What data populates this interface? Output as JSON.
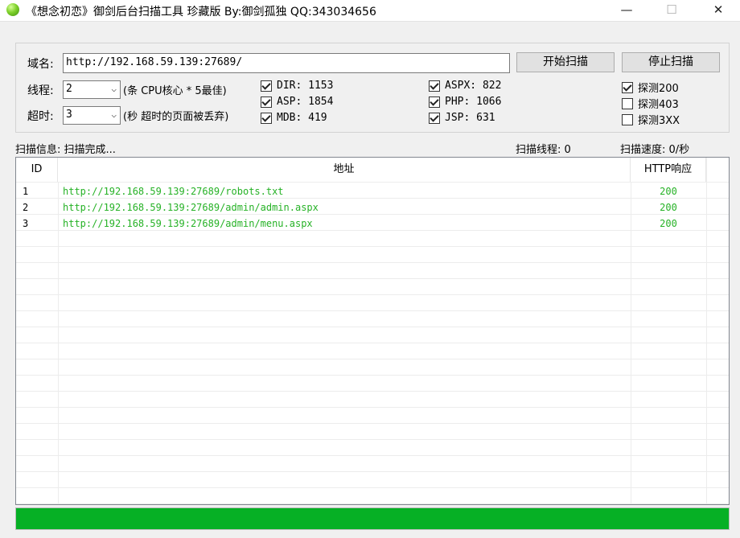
{
  "window": {
    "title": "《想念初恋》御剑后台扫描工具 珍藏版 By:御剑孤独 QQ:343034656",
    "minimize": "—",
    "maximize": "☐",
    "close": "✕"
  },
  "form": {
    "domain_label": "域名:",
    "domain_value": "http://192.168.59.139:27689/",
    "threads_label": "线程:",
    "threads_value": "2",
    "threads_hint": "(条 CPU核心 * 5最佳)",
    "timeout_label": "超时:",
    "timeout_value": "3",
    "timeout_hint": "(秒 超时的页面被丢弃)",
    "start_button": "开始扫描",
    "stop_button": "停止扫描"
  },
  "dictionaries": [
    {
      "label": "DIR: 1153",
      "checked": true
    },
    {
      "label": "ASP: 1854",
      "checked": true
    },
    {
      "label": "MDB: 419",
      "checked": true
    },
    {
      "label": "ASPX: 822",
      "checked": true
    },
    {
      "label": "PHP: 1066",
      "checked": true
    },
    {
      "label": "JSP: 631",
      "checked": true
    }
  ],
  "detect": [
    {
      "label": "探测200",
      "checked": true
    },
    {
      "label": "探测403",
      "checked": false
    },
    {
      "label": "探测3XX",
      "checked": false
    }
  ],
  "status": {
    "info": "扫描信息: 扫描完成...",
    "threads": "扫描线程: 0",
    "speed": "扫描速度: 0/秒"
  },
  "table": {
    "headers": [
      "ID",
      "地址",
      "HTTP响应"
    ],
    "rows": [
      {
        "id": "1",
        "url": "http://192.168.59.139:27689/robots.txt",
        "code": "200"
      },
      {
        "id": "2",
        "url": "http://192.168.59.139:27689/admin/admin.aspx",
        "code": "200"
      },
      {
        "id": "3",
        "url": "http://192.168.59.139:27689/admin/menu.aspx",
        "code": "200"
      }
    ]
  },
  "progress": {
    "percent": 100
  },
  "colors": {
    "progress": "#06b025",
    "result_text": "#26b226"
  }
}
